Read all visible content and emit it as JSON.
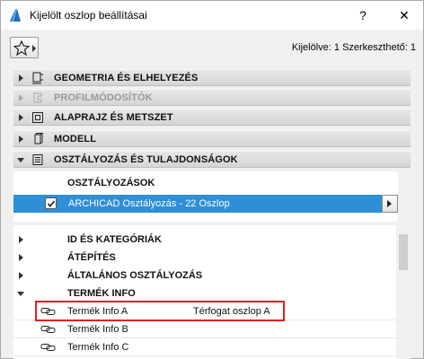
{
  "window": {
    "title": "Kijelölt oszlop beállításai",
    "help_label": "?",
    "close_label": "✕"
  },
  "toolbar": {
    "status": "Kijelölve: 1 Szerkeszthető: 1"
  },
  "panels": [
    {
      "label": "GEOMETRIA ÉS ELHELYEZÉS",
      "icon": "geometry-icon",
      "expanded": false,
      "disabled": false
    },
    {
      "label": "PROFILMÓDOSÍTÓK",
      "icon": "profile-modifier-icon",
      "expanded": false,
      "disabled": true
    },
    {
      "label": "ALAPRAJZ ÉS METSZET",
      "icon": "floorplan-icon",
      "expanded": false,
      "disabled": false
    },
    {
      "label": "MODELL",
      "icon": "model-icon",
      "expanded": false,
      "disabled": false
    },
    {
      "label": "OSZTÁLYOZÁS ÉS TULAJDONSÁGOK",
      "icon": "classification-icon",
      "expanded": true,
      "disabled": false
    }
  ],
  "classification": {
    "header": "OSZTÁLYOZÁSOK",
    "item_label": "ARCHICAD Osztályozás - 22 Oszlop",
    "checked": true
  },
  "tree": {
    "groups": [
      {
        "label": "ID ÉS KATEGÓRIÁK",
        "expanded": false
      },
      {
        "label": "ÁTÉPÍTÉS",
        "expanded": false
      },
      {
        "label": "ÁLTALÁNOS OSZTÁLYOZÁS",
        "expanded": false
      },
      {
        "label": "TERMÉK INFO",
        "expanded": true
      }
    ],
    "properties": [
      {
        "label": "Termék Info A",
        "value": "Térfogat oszlop A"
      },
      {
        "label": "Termék Info B",
        "value": ""
      },
      {
        "label": "Termék Info C",
        "value": ""
      }
    ]
  },
  "colors": {
    "selection": "#2e8fd8",
    "highlight_border": "#e02020"
  }
}
